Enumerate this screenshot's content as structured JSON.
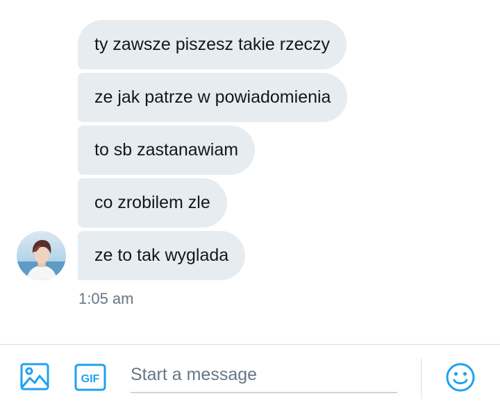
{
  "conversation": {
    "messages": [
      {
        "text": "ty zawsze piszesz takie rzeczy"
      },
      {
        "text": "ze jak patrze w powiadomienia"
      },
      {
        "text": "to sb zastanawiam"
      },
      {
        "text": "co zrobilem zle"
      },
      {
        "text": "ze to tak wyglada"
      }
    ],
    "timestamp": "1:05 am"
  },
  "composer": {
    "placeholder": "Start a message",
    "gif_label": "GIF"
  },
  "colors": {
    "accent": "#1da1f2",
    "bubble_bg": "#e6ecf0",
    "text_primary": "#14171a",
    "text_secondary": "#657786",
    "divider": "#d8dde2"
  },
  "icons": [
    "media-icon",
    "gif-icon",
    "emoji-icon"
  ]
}
